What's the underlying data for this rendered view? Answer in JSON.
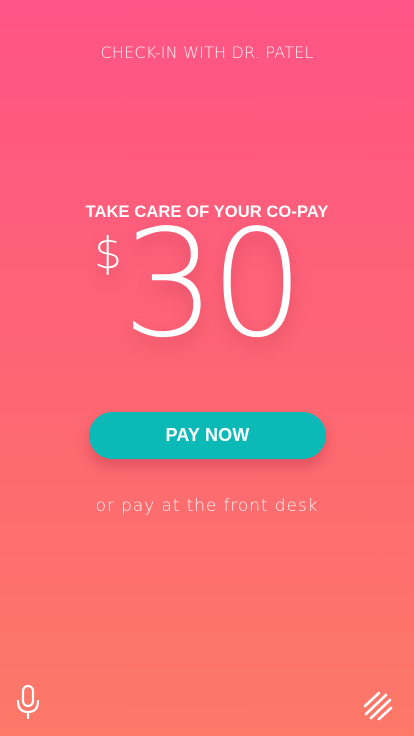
{
  "header": {
    "title": "CHECK-IN WITH DR. PATEL"
  },
  "copay": {
    "heading": "TAKE CARE OF YOUR CO-PAY",
    "currency_symbol": "$",
    "amount": "30"
  },
  "actions": {
    "pay_now_label": "PAY NOW",
    "alternative_text": "or pay at the front desk"
  },
  "footer": {
    "left_icon": "microphone-icon",
    "right_icon": "menu-lines-icon"
  },
  "colors": {
    "gradient_top": "#ff5486",
    "gradient_bottom": "#fd7968",
    "button": "#0bbab6",
    "text": "#ffffff"
  }
}
